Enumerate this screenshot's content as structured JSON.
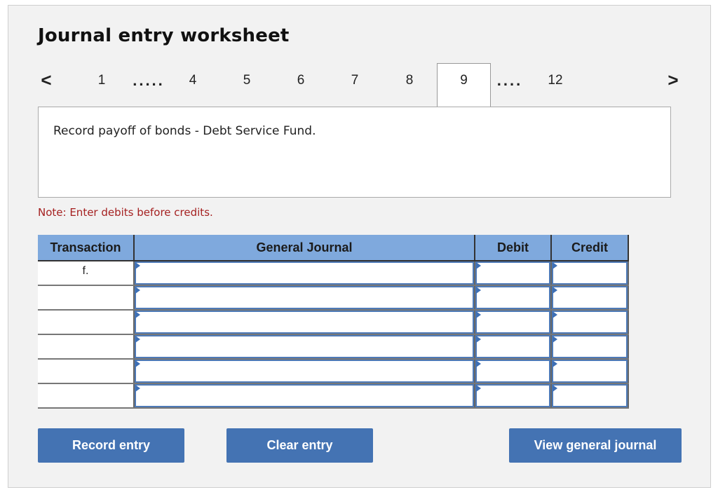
{
  "worksheet": {
    "title": "Journal entry worksheet",
    "nav": {
      "prev_icon": "chevron-left-icon",
      "next_icon": "chevron-right-icon",
      "prev_glyph": "<",
      "next_glyph": ">",
      "pages": [
        "1",
        ".....",
        "4",
        "5",
        "6",
        "7",
        "8",
        "9",
        "....",
        "12"
      ],
      "active_page": "9"
    },
    "description": "Record payoff of bonds - Debt Service Fund.",
    "note": "Note: Enter debits before credits.",
    "table": {
      "headers": [
        "Transaction",
        "General Journal",
        "Debit",
        "Credit"
      ],
      "rows": [
        {
          "transaction": "f.",
          "account": "",
          "debit": "",
          "credit": ""
        },
        {
          "transaction": "",
          "account": "",
          "debit": "",
          "credit": ""
        },
        {
          "transaction": "",
          "account": "",
          "debit": "",
          "credit": ""
        },
        {
          "transaction": "",
          "account": "",
          "debit": "",
          "credit": ""
        },
        {
          "transaction": "",
          "account": "",
          "debit": "",
          "credit": ""
        },
        {
          "transaction": "",
          "account": "",
          "debit": "",
          "credit": ""
        }
      ]
    },
    "buttons": {
      "record": "Record entry",
      "clear": "Clear entry",
      "view": "View general journal"
    },
    "colors": {
      "header_bg": "#7fa9dd",
      "button_bg": "#4473b3",
      "note_text": "#a52121"
    }
  }
}
